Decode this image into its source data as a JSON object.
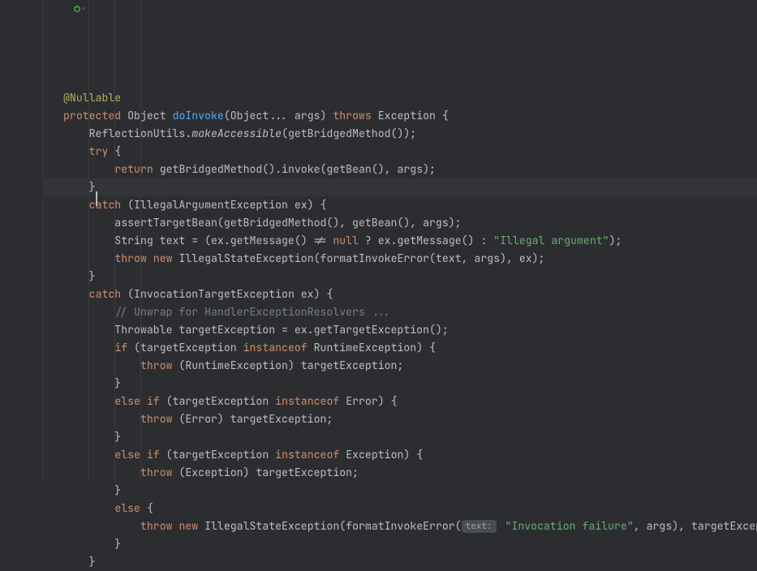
{
  "editor": {
    "override_icon": "override-method-icon",
    "lines": [
      {
        "tokens": []
      },
      {
        "tokens": [
          {
            "t": "@Nullable",
            "c": "c-annot"
          }
        ]
      },
      {
        "tokens": [
          {
            "t": "protected",
            "c": "c-keyword"
          },
          {
            "t": " Object ",
            "c": "c-text"
          },
          {
            "t": "doInvoke",
            "c": "c-def"
          },
          {
            "t": "(Object... args) ",
            "c": "c-text"
          },
          {
            "t": "throws",
            "c": "c-keyword"
          },
          {
            "t": " Exception {",
            "c": "c-text"
          }
        ]
      },
      {
        "tokens": [
          {
            "t": "    ReflectionUtils.",
            "c": "c-text"
          },
          {
            "t": "makeAccessible",
            "c": "c-static"
          },
          {
            "t": "(getBridgedMethod());",
            "c": "c-text"
          }
        ]
      },
      {
        "tokens": [
          {
            "t": "    ",
            "c": "c-text"
          },
          {
            "t": "try",
            "c": "c-keyword"
          },
          {
            "t": " {",
            "c": "c-text"
          }
        ],
        "brace_hl": true
      },
      {
        "tokens": [
          {
            "t": "        ",
            "c": "c-text"
          },
          {
            "t": "return",
            "c": "c-keyword"
          },
          {
            "t": " getBridgedMethod().invoke(getBean(), args);",
            "c": "c-text"
          }
        ]
      },
      {
        "highlighted": true,
        "tokens": [
          {
            "t": "    }",
            "c": "c-text",
            "caret_after": true
          }
        ]
      },
      {
        "tokens": [
          {
            "t": "    ",
            "c": "c-text"
          },
          {
            "t": "catch",
            "c": "c-keyword"
          },
          {
            "t": " (IllegalArgumentException ex) {",
            "c": "c-text"
          }
        ]
      },
      {
        "tokens": [
          {
            "t": "        assertTargetBean(getBridgedMethod(), getBean(), args);",
            "c": "c-text"
          }
        ]
      },
      {
        "tokens": [
          {
            "t": "        String text = (ex.getMessage() != ",
            "c": "c-text"
          },
          {
            "t": "null",
            "c": "c-keyword"
          },
          {
            "t": " ? ex.getMessage() : ",
            "c": "c-text"
          },
          {
            "t": "\"Illegal argument\"",
            "c": "c-string"
          },
          {
            "t": ");",
            "c": "c-text"
          }
        ]
      },
      {
        "tokens": [
          {
            "t": "        ",
            "c": "c-text"
          },
          {
            "t": "throw",
            "c": "c-keyword"
          },
          {
            "t": " ",
            "c": "c-text"
          },
          {
            "t": "new",
            "c": "c-keyword"
          },
          {
            "t": " IllegalStateException(formatInvokeError(text, args), ex);",
            "c": "c-text"
          }
        ]
      },
      {
        "tokens": [
          {
            "t": "    }",
            "c": "c-text"
          }
        ]
      },
      {
        "tokens": [
          {
            "t": "    ",
            "c": "c-text"
          },
          {
            "t": "catch",
            "c": "c-keyword"
          },
          {
            "t": " (InvocationTargetException ex) {",
            "c": "c-text"
          }
        ]
      },
      {
        "tokens": [
          {
            "t": "        ",
            "c": "c-text"
          },
          {
            "t": "// Unwrap for HandlerExceptionResolvers ...",
            "c": "c-comment"
          }
        ]
      },
      {
        "tokens": [
          {
            "t": "        Throwable targetException = ex.getTargetException();",
            "c": "c-text"
          }
        ]
      },
      {
        "tokens": [
          {
            "t": "        ",
            "c": "c-text"
          },
          {
            "t": "if",
            "c": "c-keyword"
          },
          {
            "t": " (targetException ",
            "c": "c-text"
          },
          {
            "t": "instanceof",
            "c": "c-keyword"
          },
          {
            "t": " RuntimeException) {",
            "c": "c-text"
          }
        ]
      },
      {
        "tokens": [
          {
            "t": "            ",
            "c": "c-text"
          },
          {
            "t": "throw",
            "c": "c-keyword"
          },
          {
            "t": " (RuntimeException) targetException;",
            "c": "c-text"
          }
        ]
      },
      {
        "tokens": [
          {
            "t": "        }",
            "c": "c-text"
          }
        ]
      },
      {
        "tokens": [
          {
            "t": "        ",
            "c": "c-text"
          },
          {
            "t": "else",
            "c": "c-keyword"
          },
          {
            "t": " ",
            "c": "c-text"
          },
          {
            "t": "if",
            "c": "c-keyword"
          },
          {
            "t": " (targetException ",
            "c": "c-text"
          },
          {
            "t": "instanceof",
            "c": "c-keyword"
          },
          {
            "t": " Error) {",
            "c": "c-text"
          }
        ]
      },
      {
        "tokens": [
          {
            "t": "            ",
            "c": "c-text"
          },
          {
            "t": "throw",
            "c": "c-keyword"
          },
          {
            "t": " (Error) targetException;",
            "c": "c-text"
          }
        ]
      },
      {
        "tokens": [
          {
            "t": "        }",
            "c": "c-text"
          }
        ]
      },
      {
        "tokens": [
          {
            "t": "        ",
            "c": "c-text"
          },
          {
            "t": "else",
            "c": "c-keyword"
          },
          {
            "t": " ",
            "c": "c-text"
          },
          {
            "t": "if",
            "c": "c-keyword"
          },
          {
            "t": " (targetException ",
            "c": "c-text"
          },
          {
            "t": "instanceof",
            "c": "c-keyword"
          },
          {
            "t": " Exception) {",
            "c": "c-text"
          }
        ]
      },
      {
        "tokens": [
          {
            "t": "            ",
            "c": "c-text"
          },
          {
            "t": "throw",
            "c": "c-keyword"
          },
          {
            "t": " (Exception) targetException;",
            "c": "c-text"
          }
        ]
      },
      {
        "tokens": [
          {
            "t": "        }",
            "c": "c-text"
          }
        ]
      },
      {
        "tokens": [
          {
            "t": "        ",
            "c": "c-text"
          },
          {
            "t": "else",
            "c": "c-keyword"
          },
          {
            "t": " {",
            "c": "c-text"
          }
        ]
      },
      {
        "tokens": [
          {
            "t": "            ",
            "c": "c-text"
          },
          {
            "t": "throw",
            "c": "c-keyword"
          },
          {
            "t": " ",
            "c": "c-text"
          },
          {
            "t": "new",
            "c": "c-keyword"
          },
          {
            "t": " IllegalStateException(formatInvokeError(",
            "c": "c-text"
          },
          {
            "hint": "text:"
          },
          {
            "t": " ",
            "c": "c-text"
          },
          {
            "t": "\"Invocation failure\"",
            "c": "c-string"
          },
          {
            "t": ", args), targetException);",
            "c": "c-text"
          }
        ]
      },
      {
        "tokens": [
          {
            "t": "        }",
            "c": "c-text"
          }
        ]
      },
      {
        "tokens": [
          {
            "t": "    }",
            "c": "c-text"
          }
        ]
      }
    ]
  }
}
